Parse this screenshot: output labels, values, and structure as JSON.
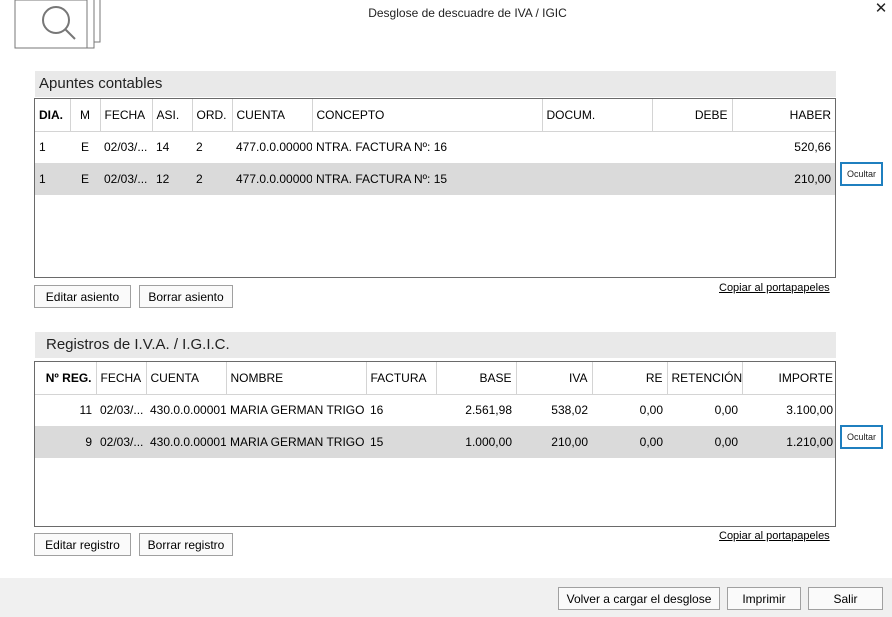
{
  "window": {
    "title": "Desglose de descuadre de IVA / IGIC",
    "close_label": "✕"
  },
  "apuntes": {
    "title": "Apuntes contables",
    "columns": [
      "DIA.",
      "M",
      "FECHA",
      "ASI.",
      "ORD.",
      "CUENTA",
      "CONCEPTO",
      "DOCUM.",
      "DEBE",
      "HABER"
    ],
    "rows": [
      [
        "1",
        "E",
        "02/03/...",
        "14",
        "2",
        "477.0.0.00000",
        "NTRA. FACTURA Nº:  16",
        "",
        "",
        "520,66"
      ],
      [
        "1",
        "E",
        "02/03/...",
        "12",
        "2",
        "477.0.0.00000",
        "NTRA. FACTURA Nº:  15",
        "",
        "",
        "210,00"
      ]
    ],
    "edit_button": "Editar asiento",
    "delete_button": "Borrar asiento",
    "copy_link": "Copiar al portapapeles",
    "hide_button": "Ocultar"
  },
  "registros": {
    "title": "Registros de I.V.A. / I.G.I.C.",
    "columns": [
      "Nº REG.",
      "FECHA",
      "CUENTA",
      "NOMBRE",
      "FACTURA",
      "BASE",
      "IVA",
      "RE",
      "RETENCIÓN",
      "IMPORTE"
    ],
    "rows": [
      [
        "11",
        "02/03/...",
        "430.0.0.00001",
        "MARIA GERMAN TRIGO",
        "16",
        "2.561,98",
        "538,02",
        "0,00",
        "0,00",
        "3.100,00"
      ],
      [
        "9",
        "02/03/...",
        "430.0.0.00001",
        "MARIA GERMAN TRIGO",
        "15",
        "1.000,00",
        "210,00",
        "0,00",
        "0,00",
        "1.210,00"
      ]
    ],
    "edit_button": "Editar registro",
    "delete_button": "Borrar registro",
    "copy_link": "Copiar al portapapeles",
    "hide_button": "Ocultar"
  },
  "footer": {
    "reload_button": "Volver a cargar el desglose",
    "print_button": "Imprimir",
    "exit_button": "Salir"
  },
  "colors": {
    "accent": "#1f7fbf",
    "selected_row": "#dadada",
    "header_band": "#e9e9e9"
  }
}
